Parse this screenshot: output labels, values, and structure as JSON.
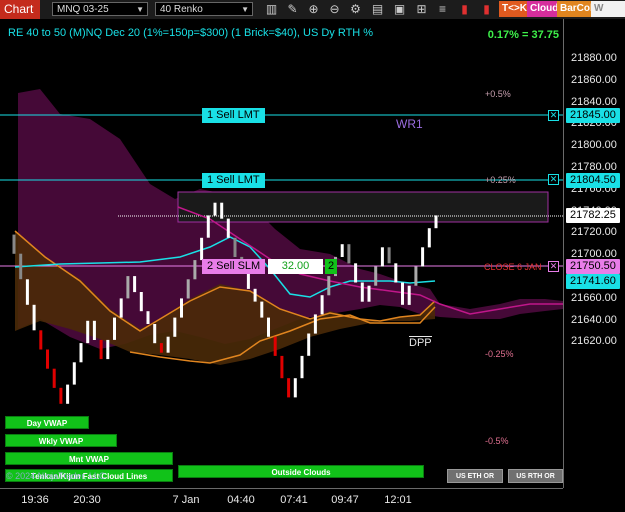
{
  "toolbar": {
    "chart_tab": "Chart",
    "instrument": "MNQ 03-25",
    "bar_type": "40 Renko",
    "badges": {
      "tk": "T<>K",
      "cloud": "Cloud",
      "barcol": "BarCol",
      "w": "W VWAP"
    },
    "icons": [
      "bar-style-icon",
      "draw-tools-icon",
      "zoom-in-icon",
      "zoom-out-icon",
      "settings-icon",
      "template-icon",
      "chart-trader-icon",
      "properties-icon",
      "instrument-list-icon",
      "strategy-icon",
      "indicator-icon",
      "pin-icon"
    ]
  },
  "header": {
    "title": "RE 40 to 50 (M)NQ Dec 20 (1%=150p=$300) (1 Brick=$40), US Dy RTH %",
    "change": "0.17% = 37.75"
  },
  "yaxis": {
    "ticks": [
      "21880.00",
      "21860.00",
      "21840.00",
      "21820.00",
      "21800.00",
      "21780.00",
      "21760.00",
      "21740.00",
      "21720.00",
      "21700.00",
      "21680.00",
      "21660.00",
      "21640.00",
      "21620.00"
    ]
  },
  "xaxis": {
    "ticks": [
      "19:36",
      "20:30",
      "7 Jan",
      "04:40",
      "07:41",
      "09:47",
      "12:01"
    ]
  },
  "price_tags": {
    "sell_lmt_1": "21845.00",
    "sell_lmt_2": "21804.50",
    "last": "21782.25",
    "sell_slm": "21750.50",
    "ma": "21741.60"
  },
  "orders": {
    "sell_lmt_1": "1 Sell LMT",
    "sell_lmt_2": "1 Sell LMT",
    "sell_slm": "2 Sell SLM",
    "slm_value": "32.00",
    "slm_qty": "2"
  },
  "annotations": {
    "p05": "+0.5%",
    "p025": "+0.25%",
    "close": "CLOSE 6 JAN",
    "m025": "-0.25%",
    "m05": "-0.5%",
    "wr1": "WR1",
    "dpp": "DPP"
  },
  "buttons": {
    "day_vwap": "Day VWAP",
    "wkly_vwap": "Wkly VWAP",
    "mnt_vwap": "Mnt VWAP",
    "cloud_lines": "Tenkan/Kijun Fast Cloud Lines",
    "outside_clouds": "Outside Clouds",
    "us_eth": "US ETH OR",
    "us_rth": "US RTH OR"
  },
  "watermark": "© 2024 NinjaTrader, LLC",
  "colors": {
    "cyan": "#19e0e6",
    "pink": "#e87de8",
    "green": "#11c219",
    "red": "#e00000",
    "cloud_purple": "#5a0a45",
    "orange": "#e0851f"
  },
  "chart_data": {
    "type": "renko",
    "brick_size": 40,
    "bricks_close": [
      21758,
      21742,
      21726,
      21710,
      21698,
      21686,
      21674,
      21664,
      21676,
      21690,
      21702,
      21716,
      21704,
      21692,
      21704,
      21718,
      21730,
      21744,
      21734,
      21722,
      21714,
      21702,
      21696,
      21706,
      21718,
      21730,
      21742,
      21754,
      21768,
      21782,
      21790,
      21780,
      21768,
      21756,
      21748,
      21736,
      21728,
      21718,
      21706,
      21694,
      21680,
      21668,
      21680,
      21694,
      21708,
      21720,
      21732,
      21744,
      21756,
      21764,
      21752,
      21740,
      21728,
      21738,
      21750,
      21762,
      21752,
      21740,
      21726,
      21738,
      21750,
      21762,
      21774,
      21782
    ]
  }
}
